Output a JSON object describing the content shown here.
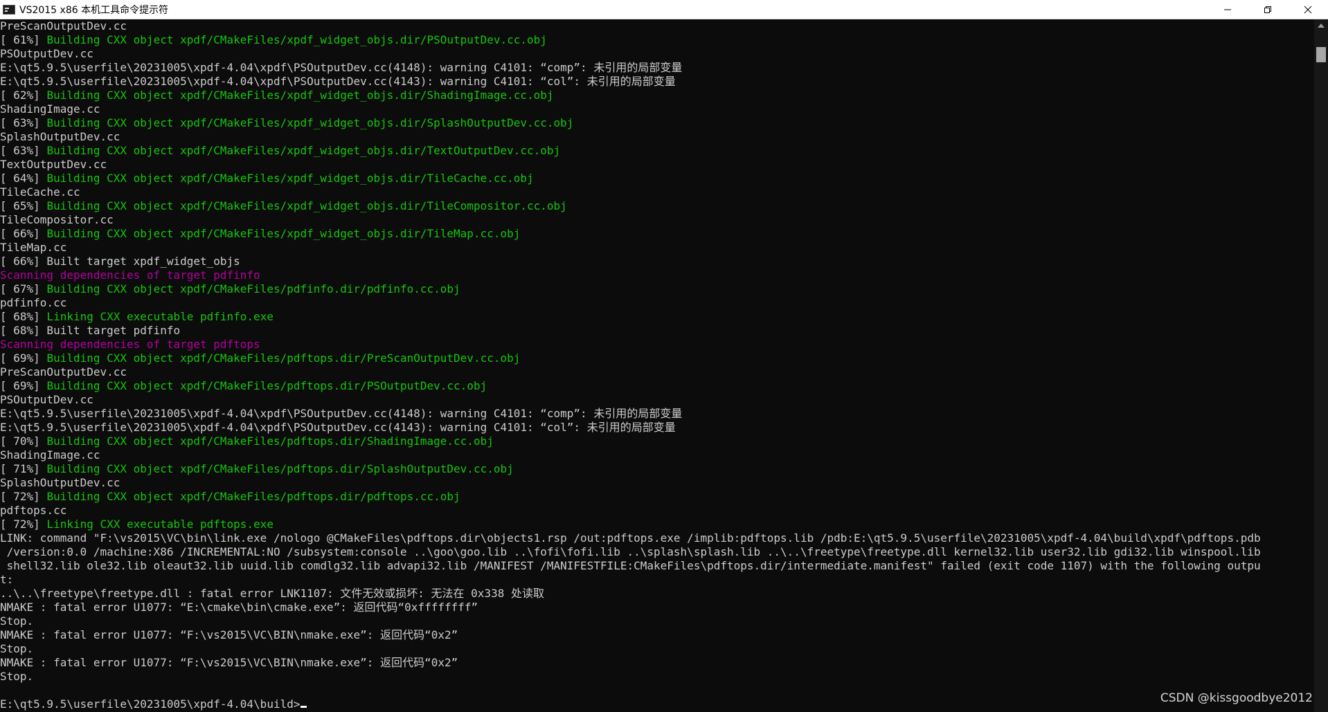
{
  "window": {
    "title": "VS2015 x86 本机工具命令提示符",
    "controls": {
      "minimize": "minimize",
      "restore": "restore",
      "close": "close"
    }
  },
  "console": {
    "lines": [
      {
        "parts": [
          {
            "text": "PreScanOutputDev.cc",
            "color": "default"
          }
        ]
      },
      {
        "parts": [
          {
            "text": "[ 61%] ",
            "color": "default"
          },
          {
            "text": "Building CXX object xpdf/CMakeFiles/xpdf_widget_objs.dir/PSOutputDev.cc.obj",
            "color": "green"
          }
        ]
      },
      {
        "parts": [
          {
            "text": "PSOutputDev.cc",
            "color": "default"
          }
        ]
      },
      {
        "parts": [
          {
            "text": "E:\\qt5.9.5\\userfile\\20231005\\xpdf-4.04\\xpdf\\PSOutputDev.cc(4148): warning C4101: “comp”: 未引用的局部变量",
            "color": "default"
          }
        ]
      },
      {
        "parts": [
          {
            "text": "E:\\qt5.9.5\\userfile\\20231005\\xpdf-4.04\\xpdf\\PSOutputDev.cc(4143): warning C4101: “col”: 未引用的局部变量",
            "color": "default"
          }
        ]
      },
      {
        "parts": [
          {
            "text": "[ 62%] ",
            "color": "default"
          },
          {
            "text": "Building CXX object xpdf/CMakeFiles/xpdf_widget_objs.dir/ShadingImage.cc.obj",
            "color": "green"
          }
        ]
      },
      {
        "parts": [
          {
            "text": "ShadingImage.cc",
            "color": "default"
          }
        ]
      },
      {
        "parts": [
          {
            "text": "[ 63%] ",
            "color": "default"
          },
          {
            "text": "Building CXX object xpdf/CMakeFiles/xpdf_widget_objs.dir/SplashOutputDev.cc.obj",
            "color": "green"
          }
        ]
      },
      {
        "parts": [
          {
            "text": "SplashOutputDev.cc",
            "color": "default"
          }
        ]
      },
      {
        "parts": [
          {
            "text": "[ 63%] ",
            "color": "default"
          },
          {
            "text": "Building CXX object xpdf/CMakeFiles/xpdf_widget_objs.dir/TextOutputDev.cc.obj",
            "color": "green"
          }
        ]
      },
      {
        "parts": [
          {
            "text": "TextOutputDev.cc",
            "color": "default"
          }
        ]
      },
      {
        "parts": [
          {
            "text": "[ 64%] ",
            "color": "default"
          },
          {
            "text": "Building CXX object xpdf/CMakeFiles/xpdf_widget_objs.dir/TileCache.cc.obj",
            "color": "green"
          }
        ]
      },
      {
        "parts": [
          {
            "text": "TileCache.cc",
            "color": "default"
          }
        ]
      },
      {
        "parts": [
          {
            "text": "[ 65%] ",
            "color": "default"
          },
          {
            "text": "Building CXX object xpdf/CMakeFiles/xpdf_widget_objs.dir/TileCompositor.cc.obj",
            "color": "green"
          }
        ]
      },
      {
        "parts": [
          {
            "text": "TileCompositor.cc",
            "color": "default"
          }
        ]
      },
      {
        "parts": [
          {
            "text": "[ 66%] ",
            "color": "default"
          },
          {
            "text": "Building CXX object xpdf/CMakeFiles/xpdf_widget_objs.dir/TileMap.cc.obj",
            "color": "green"
          }
        ]
      },
      {
        "parts": [
          {
            "text": "TileMap.cc",
            "color": "default"
          }
        ]
      },
      {
        "parts": [
          {
            "text": "[ 66%] Built target xpdf_widget_objs",
            "color": "default"
          }
        ]
      },
      {
        "parts": [
          {
            "text": "Scanning dependencies of target pdfinfo",
            "color": "magenta"
          }
        ]
      },
      {
        "parts": [
          {
            "text": "[ 67%] ",
            "color": "default"
          },
          {
            "text": "Building CXX object xpdf/CMakeFiles/pdfinfo.dir/pdfinfo.cc.obj",
            "color": "green"
          }
        ]
      },
      {
        "parts": [
          {
            "text": "pdfinfo.cc",
            "color": "default"
          }
        ]
      },
      {
        "parts": [
          {
            "text": "[ 68%] ",
            "color": "default"
          },
          {
            "text": "Linking CXX executable pdfinfo.exe",
            "color": "green"
          }
        ]
      },
      {
        "parts": [
          {
            "text": "[ 68%] Built target pdfinfo",
            "color": "default"
          }
        ]
      },
      {
        "parts": [
          {
            "text": "Scanning dependencies of target pdftops",
            "color": "magenta"
          }
        ]
      },
      {
        "parts": [
          {
            "text": "[ 69%] ",
            "color": "default"
          },
          {
            "text": "Building CXX object xpdf/CMakeFiles/pdftops.dir/PreScanOutputDev.cc.obj",
            "color": "green"
          }
        ]
      },
      {
        "parts": [
          {
            "text": "PreScanOutputDev.cc",
            "color": "default"
          }
        ]
      },
      {
        "parts": [
          {
            "text": "[ 69%] ",
            "color": "default"
          },
          {
            "text": "Building CXX object xpdf/CMakeFiles/pdftops.dir/PSOutputDev.cc.obj",
            "color": "green"
          }
        ]
      },
      {
        "parts": [
          {
            "text": "PSOutputDev.cc",
            "color": "default"
          }
        ]
      },
      {
        "parts": [
          {
            "text": "E:\\qt5.9.5\\userfile\\20231005\\xpdf-4.04\\xpdf\\PSOutputDev.cc(4148): warning C4101: “comp”: 未引用的局部变量",
            "color": "default"
          }
        ]
      },
      {
        "parts": [
          {
            "text": "E:\\qt5.9.5\\userfile\\20231005\\xpdf-4.04\\xpdf\\PSOutputDev.cc(4143): warning C4101: “col”: 未引用的局部变量",
            "color": "default"
          }
        ]
      },
      {
        "parts": [
          {
            "text": "[ 70%] ",
            "color": "default"
          },
          {
            "text": "Building CXX object xpdf/CMakeFiles/pdftops.dir/ShadingImage.cc.obj",
            "color": "green"
          }
        ]
      },
      {
        "parts": [
          {
            "text": "ShadingImage.cc",
            "color": "default"
          }
        ]
      },
      {
        "parts": [
          {
            "text": "[ 71%] ",
            "color": "default"
          },
          {
            "text": "Building CXX object xpdf/CMakeFiles/pdftops.dir/SplashOutputDev.cc.obj",
            "color": "green"
          }
        ]
      },
      {
        "parts": [
          {
            "text": "SplashOutputDev.cc",
            "color": "default"
          }
        ]
      },
      {
        "parts": [
          {
            "text": "[ 72%] ",
            "color": "default"
          },
          {
            "text": "Building CXX object xpdf/CMakeFiles/pdftops.dir/pdftops.cc.obj",
            "color": "green"
          }
        ]
      },
      {
        "parts": [
          {
            "text": "pdftops.cc",
            "color": "default"
          }
        ]
      },
      {
        "parts": [
          {
            "text": "[ 72%] ",
            "color": "default"
          },
          {
            "text": "Linking CXX executable pdftops.exe",
            "color": "green"
          }
        ]
      },
      {
        "parts": [
          {
            "text": "LINK: command \"F:\\vs2015\\VC\\bin\\link.exe /nologo @CMakeFiles\\pdftops.dir\\objects1.rsp /out:pdftops.exe /implib:pdftops.lib /pdb:E:\\qt5.9.5\\userfile\\20231005\\xpdf-4.04\\build\\xpdf\\pdftops.pdb",
            "color": "default"
          }
        ]
      },
      {
        "parts": [
          {
            "text": " /version:0.0 /machine:X86 /INCREMENTAL:NO /subsystem:console ..\\goo\\goo.lib ..\\fofi\\fofi.lib ..\\splash\\splash.lib ..\\..\\freetype\\freetype.dll kernel32.lib user32.lib gdi32.lib winspool.lib",
            "color": "default"
          }
        ]
      },
      {
        "parts": [
          {
            "text": " shell32.lib ole32.lib oleaut32.lib uuid.lib comdlg32.lib advapi32.lib /MANIFEST /MANIFESTFILE:CMakeFiles\\pdftops.dir/intermediate.manifest\" failed (exit code 1107) with the following outpu",
            "color": "default"
          }
        ]
      },
      {
        "parts": [
          {
            "text": "t:",
            "color": "default"
          }
        ]
      },
      {
        "parts": [
          {
            "text": "..\\..\\freetype\\freetype.dll : fatal error LNK1107: 文件无效或损坏: 无法在 0x338 处读取",
            "color": "default"
          }
        ]
      },
      {
        "parts": [
          {
            "text": "NMAKE : fatal error U1077: “E:\\cmake\\bin\\cmake.exe”: 返回代码“0xffffffff”",
            "color": "default"
          }
        ]
      },
      {
        "parts": [
          {
            "text": "Stop.",
            "color": "default"
          }
        ]
      },
      {
        "parts": [
          {
            "text": "NMAKE : fatal error U1077: “F:\\vs2015\\VC\\BIN\\nmake.exe”: 返回代码“0x2”",
            "color": "default"
          }
        ]
      },
      {
        "parts": [
          {
            "text": "Stop.",
            "color": "default"
          }
        ]
      },
      {
        "parts": [
          {
            "text": "NMAKE : fatal error U1077: “F:\\vs2015\\VC\\BIN\\nmake.exe”: 返回代码“0x2”",
            "color": "default"
          }
        ]
      },
      {
        "parts": [
          {
            "text": "Stop.",
            "color": "default"
          }
        ]
      },
      {
        "parts": [
          {
            "text": "",
            "color": "default"
          }
        ]
      },
      {
        "parts": [
          {
            "text": "E:\\qt5.9.5\\userfile\\20231005\\xpdf-4.04\\build>",
            "color": "default"
          }
        ],
        "cursor": true
      }
    ]
  },
  "watermark": "CSDN @kissgoodbye2012",
  "colors": {
    "background": "#0c0c0c",
    "default": "#cccccc",
    "green": "#16c60c",
    "magenta": "#b4009e"
  },
  "icons": {
    "app": "console-app-icon",
    "minimize": "minimize-icon",
    "restore": "restore-icon",
    "close": "close-icon"
  }
}
